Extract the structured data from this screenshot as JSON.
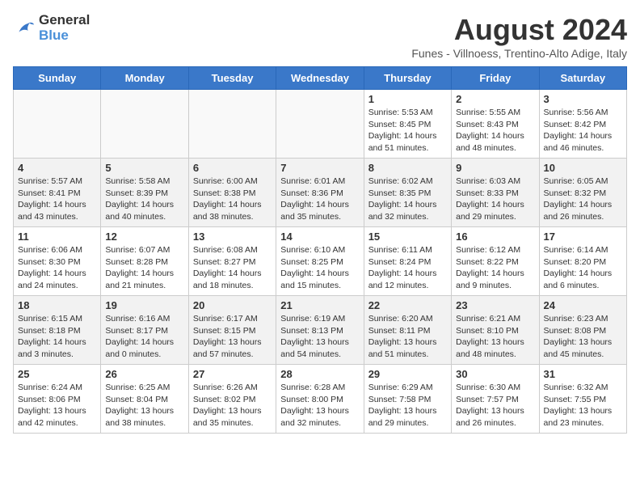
{
  "logo": {
    "line1": "General",
    "line2": "Blue"
  },
  "title": "August 2024",
  "subtitle": "Funes - Villnoess, Trentino-Alto Adige, Italy",
  "headers": [
    "Sunday",
    "Monday",
    "Tuesday",
    "Wednesday",
    "Thursday",
    "Friday",
    "Saturday"
  ],
  "weeks": [
    {
      "row_shade": "light",
      "days": [
        {
          "num": "",
          "info": ""
        },
        {
          "num": "",
          "info": ""
        },
        {
          "num": "",
          "info": ""
        },
        {
          "num": "",
          "info": ""
        },
        {
          "num": "1",
          "info": "Sunrise: 5:53 AM\nSunset: 8:45 PM\nDaylight: 14 hours\nand 51 minutes."
        },
        {
          "num": "2",
          "info": "Sunrise: 5:55 AM\nSunset: 8:43 PM\nDaylight: 14 hours\nand 48 minutes."
        },
        {
          "num": "3",
          "info": "Sunrise: 5:56 AM\nSunset: 8:42 PM\nDaylight: 14 hours\nand 46 minutes."
        }
      ]
    },
    {
      "row_shade": "dark",
      "days": [
        {
          "num": "4",
          "info": "Sunrise: 5:57 AM\nSunset: 8:41 PM\nDaylight: 14 hours\nand 43 minutes."
        },
        {
          "num": "5",
          "info": "Sunrise: 5:58 AM\nSunset: 8:39 PM\nDaylight: 14 hours\nand 40 minutes."
        },
        {
          "num": "6",
          "info": "Sunrise: 6:00 AM\nSunset: 8:38 PM\nDaylight: 14 hours\nand 38 minutes."
        },
        {
          "num": "7",
          "info": "Sunrise: 6:01 AM\nSunset: 8:36 PM\nDaylight: 14 hours\nand 35 minutes."
        },
        {
          "num": "8",
          "info": "Sunrise: 6:02 AM\nSunset: 8:35 PM\nDaylight: 14 hours\nand 32 minutes."
        },
        {
          "num": "9",
          "info": "Sunrise: 6:03 AM\nSunset: 8:33 PM\nDaylight: 14 hours\nand 29 minutes."
        },
        {
          "num": "10",
          "info": "Sunrise: 6:05 AM\nSunset: 8:32 PM\nDaylight: 14 hours\nand 26 minutes."
        }
      ]
    },
    {
      "row_shade": "light",
      "days": [
        {
          "num": "11",
          "info": "Sunrise: 6:06 AM\nSunset: 8:30 PM\nDaylight: 14 hours\nand 24 minutes."
        },
        {
          "num": "12",
          "info": "Sunrise: 6:07 AM\nSunset: 8:28 PM\nDaylight: 14 hours\nand 21 minutes."
        },
        {
          "num": "13",
          "info": "Sunrise: 6:08 AM\nSunset: 8:27 PM\nDaylight: 14 hours\nand 18 minutes."
        },
        {
          "num": "14",
          "info": "Sunrise: 6:10 AM\nSunset: 8:25 PM\nDaylight: 14 hours\nand 15 minutes."
        },
        {
          "num": "15",
          "info": "Sunrise: 6:11 AM\nSunset: 8:24 PM\nDaylight: 14 hours\nand 12 minutes."
        },
        {
          "num": "16",
          "info": "Sunrise: 6:12 AM\nSunset: 8:22 PM\nDaylight: 14 hours\nand 9 minutes."
        },
        {
          "num": "17",
          "info": "Sunrise: 6:14 AM\nSunset: 8:20 PM\nDaylight: 14 hours\nand 6 minutes."
        }
      ]
    },
    {
      "row_shade": "dark",
      "days": [
        {
          "num": "18",
          "info": "Sunrise: 6:15 AM\nSunset: 8:18 PM\nDaylight: 14 hours\nand 3 minutes."
        },
        {
          "num": "19",
          "info": "Sunrise: 6:16 AM\nSunset: 8:17 PM\nDaylight: 14 hours\nand 0 minutes."
        },
        {
          "num": "20",
          "info": "Sunrise: 6:17 AM\nSunset: 8:15 PM\nDaylight: 13 hours\nand 57 minutes."
        },
        {
          "num": "21",
          "info": "Sunrise: 6:19 AM\nSunset: 8:13 PM\nDaylight: 13 hours\nand 54 minutes."
        },
        {
          "num": "22",
          "info": "Sunrise: 6:20 AM\nSunset: 8:11 PM\nDaylight: 13 hours\nand 51 minutes."
        },
        {
          "num": "23",
          "info": "Sunrise: 6:21 AM\nSunset: 8:10 PM\nDaylight: 13 hours\nand 48 minutes."
        },
        {
          "num": "24",
          "info": "Sunrise: 6:23 AM\nSunset: 8:08 PM\nDaylight: 13 hours\nand 45 minutes."
        }
      ]
    },
    {
      "row_shade": "light",
      "days": [
        {
          "num": "25",
          "info": "Sunrise: 6:24 AM\nSunset: 8:06 PM\nDaylight: 13 hours\nand 42 minutes."
        },
        {
          "num": "26",
          "info": "Sunrise: 6:25 AM\nSunset: 8:04 PM\nDaylight: 13 hours\nand 38 minutes."
        },
        {
          "num": "27",
          "info": "Sunrise: 6:26 AM\nSunset: 8:02 PM\nDaylight: 13 hours\nand 35 minutes."
        },
        {
          "num": "28",
          "info": "Sunrise: 6:28 AM\nSunset: 8:00 PM\nDaylight: 13 hours\nand 32 minutes."
        },
        {
          "num": "29",
          "info": "Sunrise: 6:29 AM\nSunset: 7:58 PM\nDaylight: 13 hours\nand 29 minutes."
        },
        {
          "num": "30",
          "info": "Sunrise: 6:30 AM\nSunset: 7:57 PM\nDaylight: 13 hours\nand 26 minutes."
        },
        {
          "num": "31",
          "info": "Sunrise: 6:32 AM\nSunset: 7:55 PM\nDaylight: 13 hours\nand 23 minutes."
        }
      ]
    }
  ]
}
